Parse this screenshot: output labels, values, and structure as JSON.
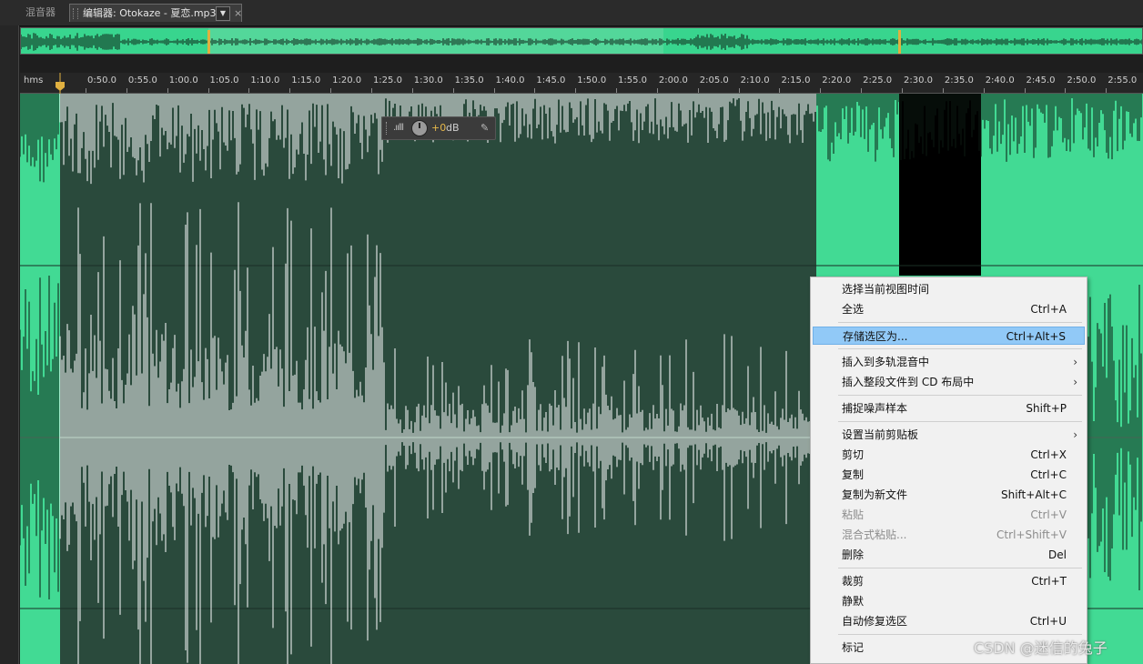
{
  "tabs": {
    "mixer": "混音器",
    "editor": "编辑器: Otokaze - 夏恋.mp3",
    "dropdown": "▼",
    "close": "×"
  },
  "ruler": {
    "unit": "hms",
    "ticks": [
      "0:50.0",
      "0:55.0",
      "1:00.0",
      "1:05.0",
      "1:10.0",
      "1:15.0",
      "1:20.0",
      "1:25.0",
      "1:30.0",
      "1:35.0",
      "1:40.0",
      "1:45.0",
      "1:50.0",
      "1:55.0",
      "2:00.0",
      "2:05.0",
      "2:10.0",
      "2:15.0",
      "2:20.0",
      "2:25.0",
      "2:30.0",
      "2:35.0",
      "2:40.0",
      "2:45.0",
      "2:50.0",
      "2:55.0"
    ]
  },
  "hud": {
    "gain_value": "+0",
    "gain_unit": "dB",
    "bars_glyph": ".ıılll",
    "pin_glyph": "✎"
  },
  "colors": {
    "waveform_bg": "#42da94",
    "selection_bg": "#2a4a3c",
    "highlight": "#91c9f7"
  },
  "context_menu": {
    "items": [
      {
        "label": "选择当前视图时间",
        "shortcut": ""
      },
      {
        "label": "全选",
        "shortcut": "Ctrl+A"
      },
      {
        "label": "存储选区为...",
        "shortcut": "Ctrl+Alt+S"
      },
      {
        "label": "插入到多轨混音中",
        "shortcut": ""
      },
      {
        "label": "插入整段文件到 CD 布局中",
        "shortcut": ""
      },
      {
        "label": "捕捉噪声样本",
        "shortcut": "Shift+P"
      },
      {
        "label": "设置当前剪贴板",
        "shortcut": ""
      },
      {
        "label": "剪切",
        "shortcut": "Ctrl+X"
      },
      {
        "label": "复制",
        "shortcut": "Ctrl+C"
      },
      {
        "label": "复制为新文件",
        "shortcut": "Shift+Alt+C"
      },
      {
        "label": "粘贴",
        "shortcut": "Ctrl+V"
      },
      {
        "label": "混合式粘贴...",
        "shortcut": "Ctrl+Shift+V"
      },
      {
        "label": "删除",
        "shortcut": "Del"
      },
      {
        "label": "裁剪",
        "shortcut": "Ctrl+T"
      },
      {
        "label": "静默",
        "shortcut": ""
      },
      {
        "label": "自动修复选区",
        "shortcut": "Ctrl+U"
      },
      {
        "label": "标记",
        "shortcut": ""
      }
    ],
    "submenu_arrow": "›"
  },
  "watermark": "CSDN @迷信的兔子"
}
